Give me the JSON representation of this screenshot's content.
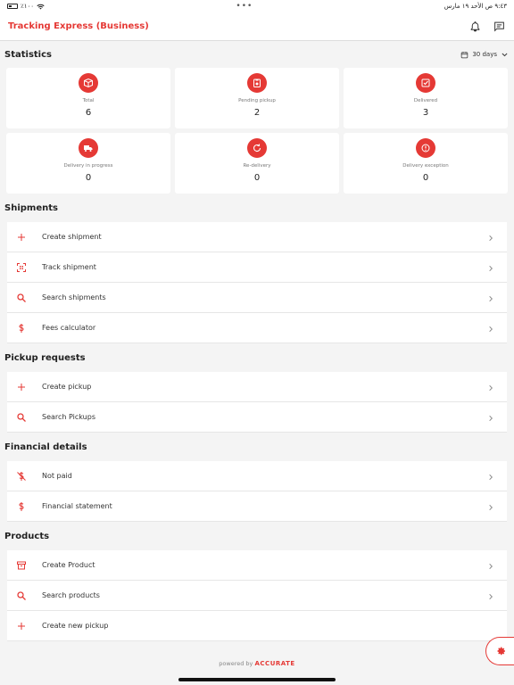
{
  "statusbar": {
    "time": "٩:٤٣ ص  الأحد ١٩ مارس",
    "battery": "٪١٠٠"
  },
  "app": {
    "title": "Tracking Express (Business)"
  },
  "statistics": {
    "title": "Statistics",
    "period": "30 days",
    "cards": [
      {
        "icon": "box-icon",
        "label": "Total",
        "value": "6"
      },
      {
        "icon": "pending-pickup-icon",
        "label": "Pending pickup",
        "value": "2"
      },
      {
        "icon": "delivered-icon",
        "label": "Delivered",
        "value": "3"
      },
      {
        "icon": "truck-icon",
        "label": "Delivery in progress",
        "value": "0"
      },
      {
        "icon": "redelivery-icon",
        "label": "Re-delivery",
        "value": "0"
      },
      {
        "icon": "exception-icon",
        "label": "Delivery exception",
        "value": "0"
      }
    ]
  },
  "shipments": {
    "title": "Shipments",
    "items": [
      {
        "icon": "plus-icon",
        "label": "Create shipment"
      },
      {
        "icon": "qr-scan-icon",
        "label": "Track shipment"
      },
      {
        "icon": "search-icon",
        "label": "Search shipments"
      },
      {
        "icon": "dollar-icon",
        "label": "Fees calculator"
      }
    ]
  },
  "pickups": {
    "title": "Pickup requests",
    "items": [
      {
        "icon": "plus-icon",
        "label": "Create pickup"
      },
      {
        "icon": "search-icon",
        "label": "Search Pickups"
      }
    ]
  },
  "financial": {
    "title": "Financial details",
    "items": [
      {
        "icon": "no-money-icon",
        "label": "Not paid"
      },
      {
        "icon": "dollar-icon",
        "label": "Financial statement"
      }
    ]
  },
  "products": {
    "title": "Products",
    "items": [
      {
        "icon": "archive-icon",
        "label": "Create Product"
      },
      {
        "icon": "search-icon",
        "label": "Search products"
      },
      {
        "icon": "plus-icon",
        "label": "Create new pickup"
      }
    ]
  },
  "footer": {
    "powered": "powered by",
    "brand": "ACCURATE"
  },
  "colors": {
    "accent": "#e53935",
    "background": "#f4f4f4"
  }
}
